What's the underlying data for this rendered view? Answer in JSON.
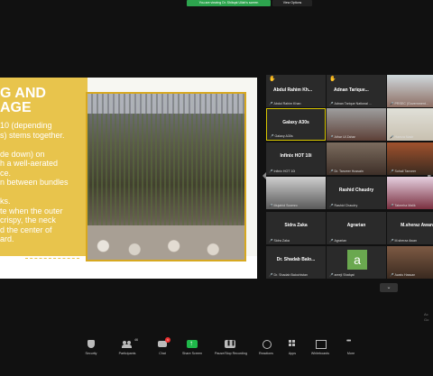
{
  "banner": {
    "viewing": "You are viewing Dr. Shibqat Ullah's screen",
    "view_options": "View Options"
  },
  "slide": {
    "title": "G AND\nAGE",
    "body": "10 (depending\ns) stems together.\n\nde down) on\nh a well-aerated\nce.\nn between bundles\n\nks.\nte when the outer\ncrispy, the neck\nd the center of\nard."
  },
  "participants": [
    {
      "label": "Abdul Rahim Kh...",
      "name": "Abdul Rahim Khan",
      "hand": true,
      "kind": "text"
    },
    {
      "label": "Adnan Tarique...",
      "name": "Adnan Tarique National ...",
      "hand": true,
      "kind": "text"
    },
    {
      "label": "",
      "name": "PRSEC (Government...",
      "hand": false,
      "kind": "video"
    },
    {
      "label": "Galaxy A30s",
      "name": "Galaxy A30s",
      "hand": false,
      "kind": "text",
      "active": true
    },
    {
      "label": "",
      "name": "Athar Ul Zahar",
      "hand": false,
      "kind": "video"
    },
    {
      "label": "",
      "name": "Hamza Nasir",
      "hand": false,
      "kind": "video"
    },
    {
      "label": "Infinix HOT 10i",
      "name": "Infinix HOT 10i",
      "hand": false,
      "kind": "text"
    },
    {
      "label": "",
      "name": "Dr. Tanveer Hussain",
      "hand": false,
      "kind": "video"
    },
    {
      "label": "",
      "name": "Sohail Tanveer",
      "hand": false,
      "kind": "video"
    },
    {
      "label": "",
      "name": "Mujahid Soomro",
      "hand": false,
      "kind": "video"
    },
    {
      "label": "Rashid Chaudry",
      "name": "Rashid Chaudry",
      "hand": false,
      "kind": "text"
    },
    {
      "label": "",
      "name": "Tabeeha Malik",
      "hand": false,
      "kind": "video"
    },
    {
      "label": "Sidra Zaka",
      "name": "Sidra Zaka",
      "hand": false,
      "kind": "text"
    },
    {
      "label": "Agrarian",
      "name": "Agrarian",
      "hand": false,
      "kind": "text"
    },
    {
      "label": "M.sheraz Awan",
      "name": "M.sheraz Awan",
      "hand": false,
      "kind": "text"
    },
    {
      "label": "Dr. Shadab Balo...",
      "name": "Dr. Shadab Balochistan",
      "hand": false,
      "kind": "text"
    },
    {
      "label": "",
      "name": "areeji Shafqat",
      "hand": false,
      "kind": "avatar",
      "avatar": "a"
    },
    {
      "label": "",
      "name": "Awais Hassan",
      "hand": false,
      "kind": "video"
    }
  ],
  "side_text": {
    "l1": "Ac",
    "l2": "Go"
  },
  "toolbar": {
    "security": "Security",
    "participants": "Participants",
    "participants_count": "46",
    "chat": "Chat",
    "chat_badge": "1",
    "share": "Share Screen",
    "pause": "Pause/Stop Recording",
    "reactions": "Reactions",
    "apps": "Apps",
    "whiteboards": "Whiteboards",
    "more": "More"
  },
  "colors": {
    "green_banner": "#2da44e",
    "slide_gold": "#e8c44c",
    "active_border": "#d9c700"
  }
}
